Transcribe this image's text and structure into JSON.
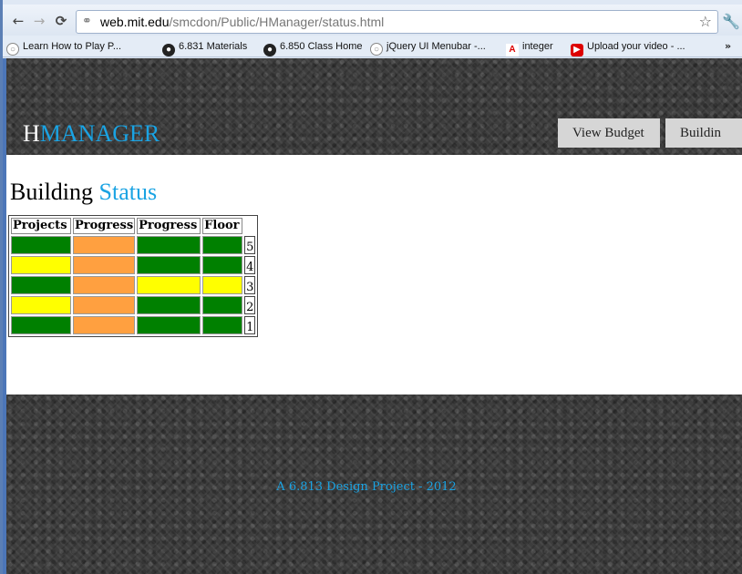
{
  "browser": {
    "url_host": "web.mit.edu",
    "url_path": "/smcdon/Public/HManager/status.html",
    "bookmarks": [
      {
        "label": "Learn How to Play P...",
        "icon": "globe-icon"
      },
      {
        "label": "6.831 Materials",
        "icon": "site-icon"
      },
      {
        "label": "6.850 Class Home",
        "icon": "site-icon"
      },
      {
        "label": "jQuery UI Menubar -...",
        "icon": "globe-icon"
      },
      {
        "label": "integer",
        "icon": "adobe-icon"
      },
      {
        "label": "Upload your video - ...",
        "icon": "youtube-icon"
      }
    ],
    "more": "»"
  },
  "header": {
    "logo_first": "H",
    "logo_rest": "MANAGER",
    "nav": [
      "View Budget",
      "Buildin"
    ]
  },
  "main": {
    "title_a": "Building",
    "title_b": "Status",
    "table": {
      "headers": [
        "Projects",
        "Progress",
        "Progress",
        "Floor"
      ],
      "rows": [
        {
          "cells": [
            "#008000",
            "#ffa040",
            "#008000",
            "#008000"
          ],
          "floor": "5"
        },
        {
          "cells": [
            "#ffff00",
            "#ffa040",
            "#008000",
            "#008000"
          ],
          "floor": "4"
        },
        {
          "cells": [
            "#008000",
            "#ffa040",
            "#ffff00",
            "#ffff00"
          ],
          "floor": "3"
        },
        {
          "cells": [
            "#ffff00",
            "#ffa040",
            "#008000",
            "#008000"
          ],
          "floor": "2"
        },
        {
          "cells": [
            "#008000",
            "#ffa040",
            "#008000",
            "#008000"
          ],
          "floor": "1"
        }
      ]
    }
  },
  "footer": {
    "text": "A 6.813 Design Project - 2012"
  }
}
